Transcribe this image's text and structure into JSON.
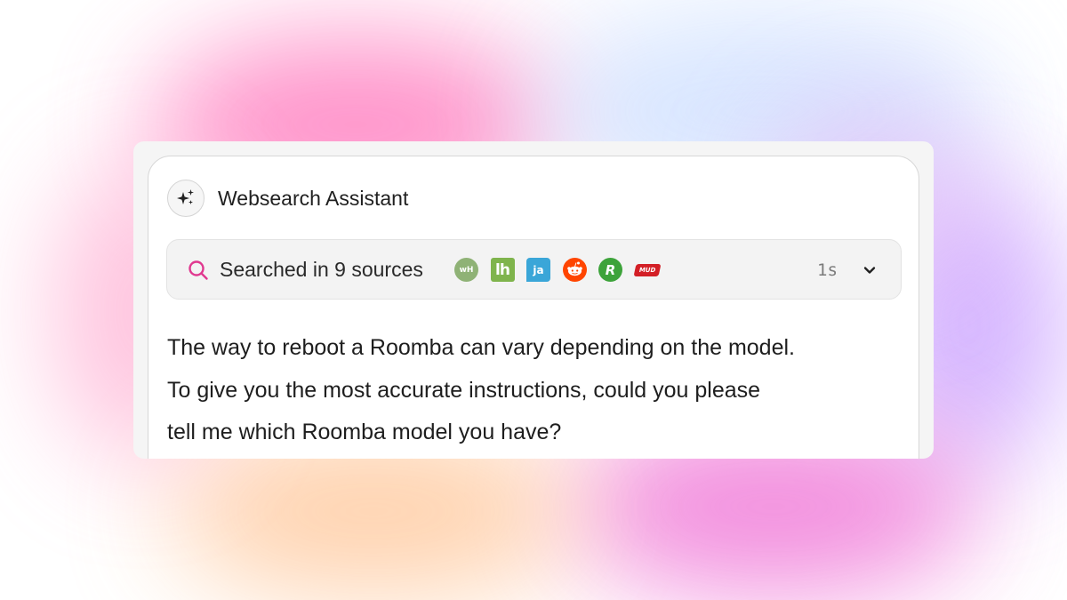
{
  "assistant": {
    "title": "Websearch Assistant",
    "avatar_icon": "sparkles-icon"
  },
  "search": {
    "label": "Searched in 9 sources",
    "icon": "search-icon",
    "icon_color": "#e0388f",
    "duration": "1s",
    "sources": [
      {
        "name": "wikihow-icon",
        "text": "wH"
      },
      {
        "name": "lifehacker-icon",
        "text": "lh"
      },
      {
        "name": "justanswer-icon",
        "text": "ja"
      },
      {
        "name": "reddit-icon",
        "text": ""
      },
      {
        "name": "r-icon",
        "text": "R"
      },
      {
        "name": "mud-icon",
        "text": "MUD"
      }
    ]
  },
  "message": {
    "text": "The way to reboot a Roomba can vary depending on the model.\nTo give you the most accurate instructions, could you please\ntell me which Roomba model you have?"
  }
}
